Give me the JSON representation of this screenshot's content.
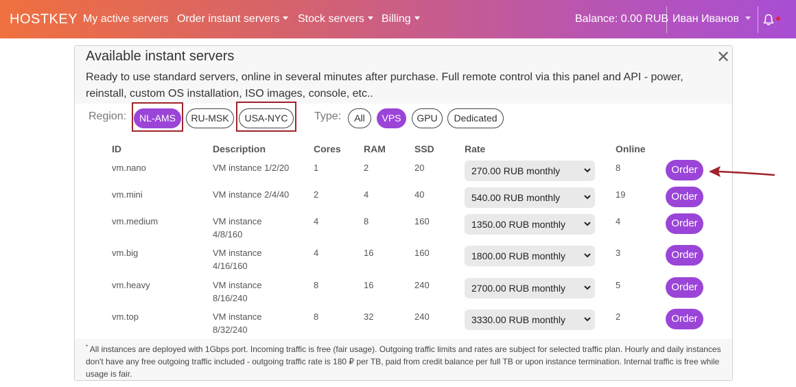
{
  "navbar": {
    "brand": "HOSTKEY",
    "items": [
      {
        "label": "My active servers"
      },
      {
        "label": "Order instant servers"
      },
      {
        "label": "Stock servers"
      },
      {
        "label": "Billing"
      }
    ],
    "balance": "Balance: 0.00 RUB",
    "user": "Иван Иванов",
    "colors": {
      "gradient_start": "#f0703f",
      "gradient_end": "#a84ed4"
    }
  },
  "panel": {
    "title": "Available instant servers",
    "description": "Ready to use standard servers, online in several minutes after purchase. Full remote control via this panel and API - power, reinstall, custom OS installation, ISO images, console, etc..",
    "region_label": "Region:",
    "regions": [
      {
        "label": "NL-AMS",
        "active": true
      },
      {
        "label": "RU-MSK",
        "active": false
      },
      {
        "label": "USA-NYC",
        "active": false
      }
    ],
    "type_label": "Type:",
    "types": [
      {
        "label": "All",
        "active": false
      },
      {
        "label": "VPS",
        "active": true
      },
      {
        "label": "GPU",
        "active": false
      },
      {
        "label": "Dedicated",
        "active": false
      }
    ],
    "columns": {
      "id": "ID",
      "description": "Description",
      "cores": "Cores",
      "ram": "RAM",
      "ssd": "SSD",
      "rate": "Rate",
      "online": "Online"
    },
    "rows": [
      {
        "id": "vm.nano",
        "desc1": "VM instance 1/2/20",
        "desc2": "",
        "cores": "1",
        "ram": "2",
        "ssd": "20",
        "rate": "270.00 RUB monthly",
        "online": "8",
        "order": "Order"
      },
      {
        "id": "vm.mini",
        "desc1": "VM instance 2/4/40",
        "desc2": "",
        "cores": "2",
        "ram": "4",
        "ssd": "40",
        "rate": "540.00 RUB monthly",
        "online": "19",
        "order": "Order"
      },
      {
        "id": "vm.medium",
        "desc1": "VM instance",
        "desc2": "4/8/160",
        "cores": "4",
        "ram": "8",
        "ssd": "160",
        "rate": "1350.00 RUB monthly",
        "online": "4",
        "order": "Order"
      },
      {
        "id": "vm.big",
        "desc1": "VM instance",
        "desc2": "4/16/160",
        "cores": "4",
        "ram": "16",
        "ssd": "160",
        "rate": "1800.00 RUB monthly",
        "online": "3",
        "order": "Order"
      },
      {
        "id": "vm.heavy",
        "desc1": "VM instance",
        "desc2": "8/16/240",
        "cores": "8",
        "ram": "16",
        "ssd": "240",
        "rate": "2700.00 RUB monthly",
        "online": "5",
        "order": "Order"
      },
      {
        "id": "vm.top",
        "desc1": "VM instance",
        "desc2": "8/32/240",
        "cores": "8",
        "ram": "32",
        "ssd": "240",
        "rate": "3330.00 RUB monthly",
        "online": "2",
        "order": "Order"
      }
    ],
    "footnote_mark": "*",
    "footnote": "All instances are deployed with 1Gbps port. Incoming traffic is free (fair usage). Outgoing traffic limits and rates are subject for selected traffic plan. Hourly and daily instances don't have any free outgoing traffic included - outgoing traffic rate is 180 ₽ per TB, paid from credit balance per full TB or upon instance termination. Internal traffic is free while usage is fair.",
    "colors": {
      "accent": "#9b45d8",
      "highlight_box": "#a0242a",
      "arrow": "#a0242a"
    }
  }
}
